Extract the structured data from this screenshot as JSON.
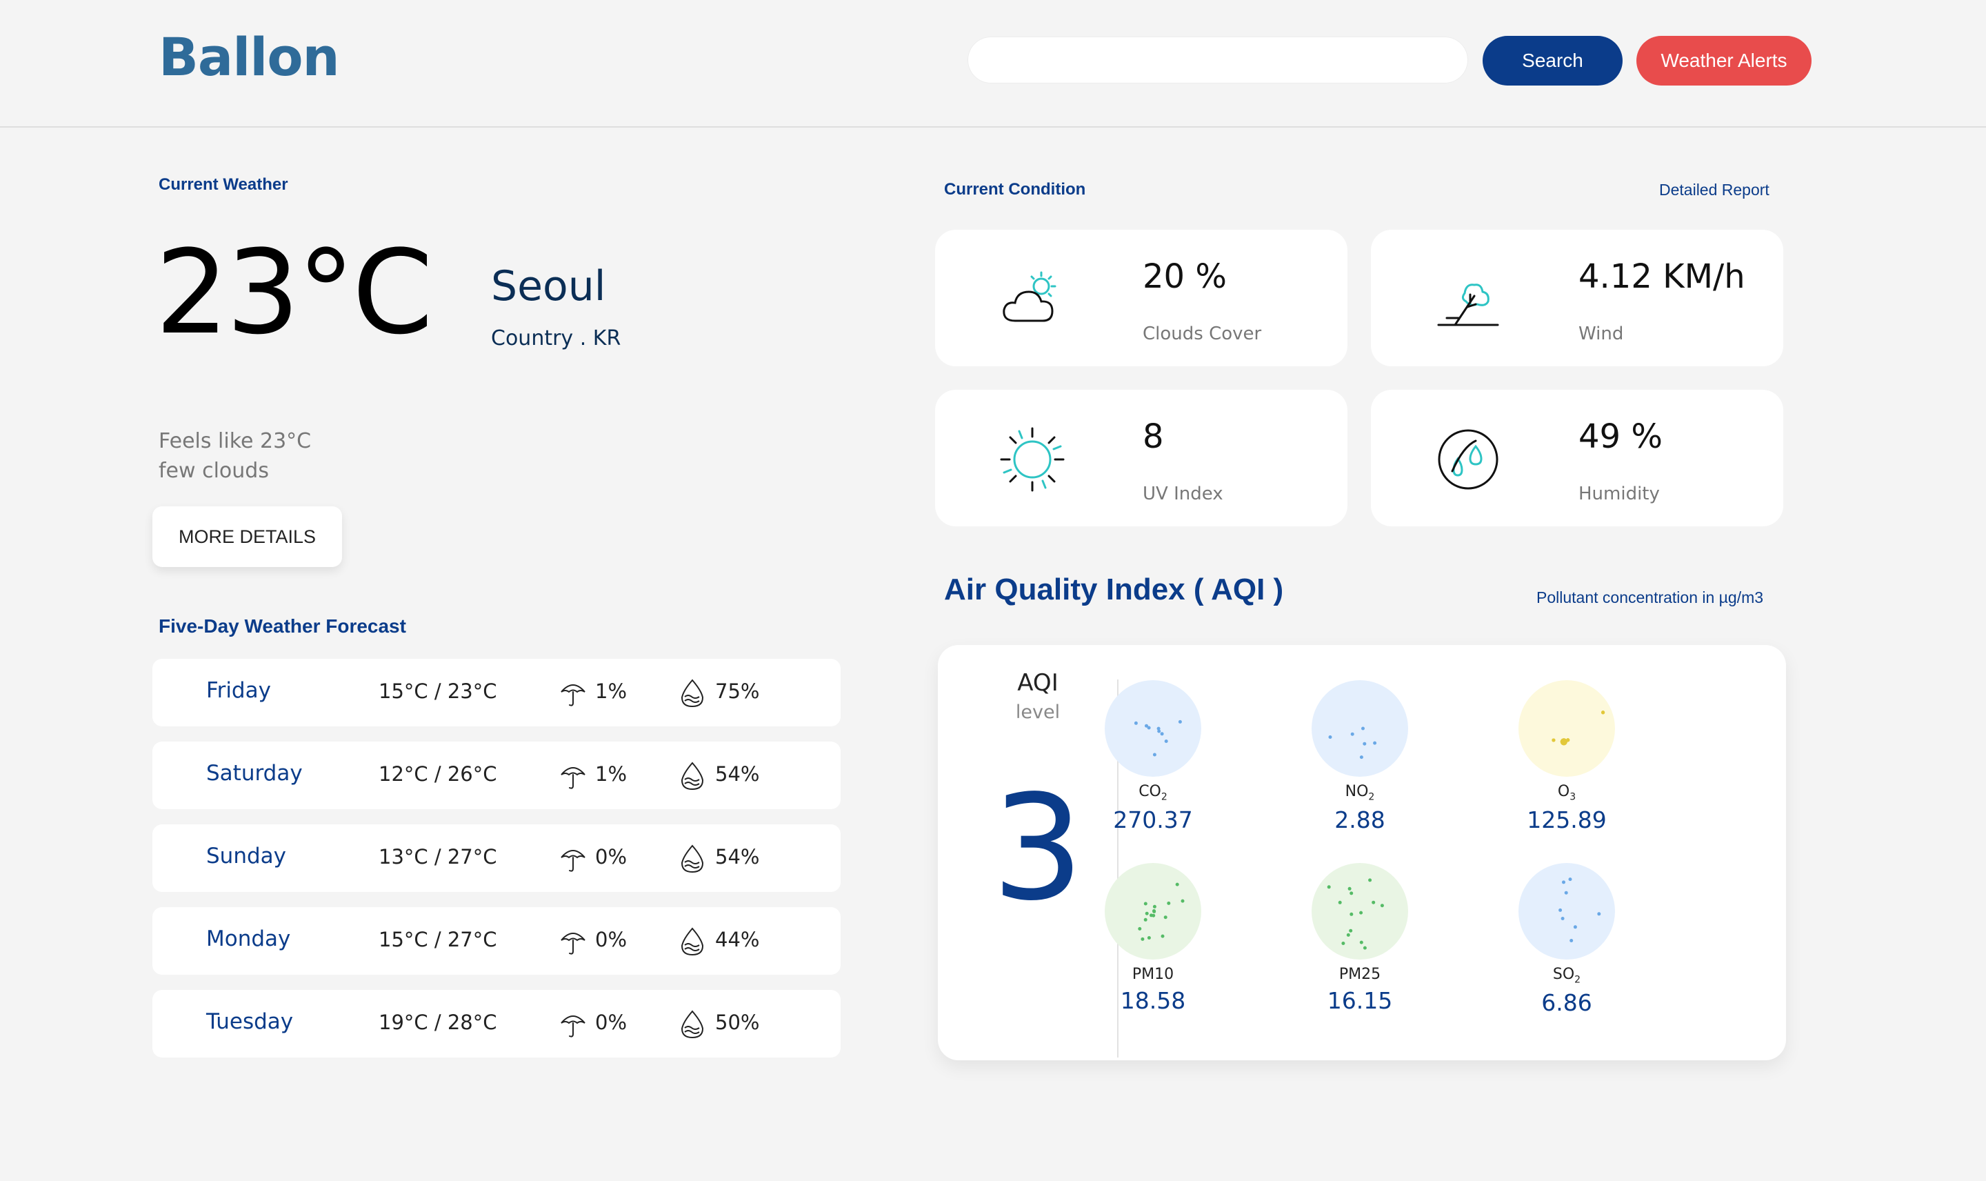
{
  "header": {
    "logo": "Ballon",
    "search_placeholder": "",
    "search_button": "Search",
    "alerts_button": "Weather Alerts"
  },
  "current_weather": {
    "label": "Current Weather",
    "temperature": "23°C",
    "city": "Seoul",
    "country": "Country . KR",
    "feels_like": "Feels like 23°C",
    "description": "few clouds",
    "more_button": "MORE DETAILS"
  },
  "forecast": {
    "label": "Five-Day Weather Forecast",
    "days": [
      {
        "day": "Friday",
        "temps": "15°C / 23°C",
        "rain": "1%",
        "humidity": "75%"
      },
      {
        "day": "Saturday",
        "temps": "12°C / 26°C",
        "rain": "1%",
        "humidity": "54%"
      },
      {
        "day": "Sunday",
        "temps": "13°C / 27°C",
        "rain": "0%",
        "humidity": "54%"
      },
      {
        "day": "Monday",
        "temps": "15°C / 27°C",
        "rain": "0%",
        "humidity": "44%"
      },
      {
        "day": "Tuesday",
        "temps": "19°C / 28°C",
        "rain": "0%",
        "humidity": "50%"
      }
    ]
  },
  "condition": {
    "label": "Current Condition",
    "report_link": "Detailed Report",
    "cards": [
      {
        "value": "20 %",
        "label": "Clouds Cover",
        "icon": "cloud-sun-icon"
      },
      {
        "value": "4.12 KM/h",
        "label": "Wind",
        "icon": "wind-tree-icon"
      },
      {
        "value": "8",
        "label": "UV Index",
        "icon": "sun-icon"
      },
      {
        "value": "49 %",
        "label": "Humidity",
        "icon": "humidity-drops-icon"
      }
    ]
  },
  "aqi": {
    "title": "Air Quality Index ( AQI )",
    "unit_note": "Pollutant concentration in µg/m3",
    "label": "AQI",
    "sublabel": "level",
    "value": "3",
    "pollutants": [
      {
        "name": "CO",
        "sub": "2",
        "value": "270.37",
        "color": "#e4effd"
      },
      {
        "name": "NO",
        "sub": "2",
        "value": "2.88",
        "color": "#e4effd"
      },
      {
        "name": "O",
        "sub": "3",
        "value": "125.89",
        "color": "#fdf9dc"
      },
      {
        "name": "PM10",
        "sub": "",
        "value": "18.58",
        "color": "#e9f5e4"
      },
      {
        "name": "PM25",
        "sub": "",
        "value": "16.15",
        "color": "#e9f5e4"
      },
      {
        "name": "SO",
        "sub": "2",
        "value": "6.86",
        "color": "#e4effd"
      }
    ]
  },
  "colors": {
    "brand": "#2f6b99",
    "primary": "#0b3c8a",
    "alert": "#e84c4c",
    "icon_accent": "#2ec4c4"
  }
}
